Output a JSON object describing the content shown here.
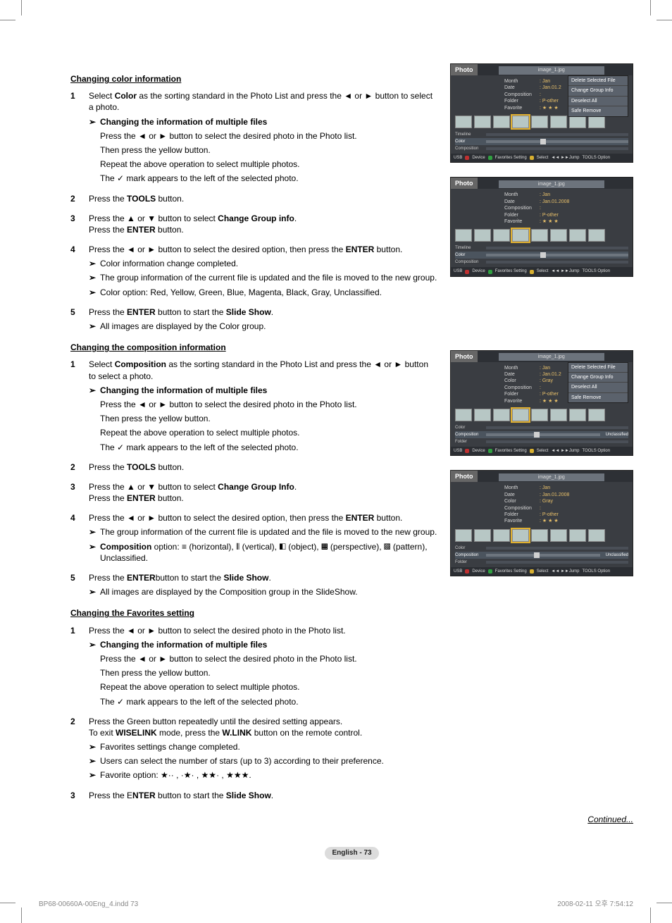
{
  "sections": {
    "color": {
      "heading": "Changing color information",
      "steps": [
        {
          "n": "1",
          "lines": [
            "Select ",
            "Color",
            " as the sorting standard in the Photo List and press the ◄ or ► button to select a photo."
          ],
          "sub": [
            {
              "t": "Changing the information of multiple files",
              "bold": true
            },
            {
              "t": "Press the ◄ or ► button to select the desired photo in the Photo list."
            },
            {
              "t": "Then press the yellow button."
            },
            {
              "t": "Repeat the above operation to select multiple photos."
            },
            {
              "t": "The ✓ mark appears to the left of the selected photo."
            }
          ]
        },
        {
          "n": "2",
          "lines": [
            "Press the ",
            "TOOLS",
            " button."
          ]
        },
        {
          "n": "3",
          "lines": [
            "Press the ▲ or ▼ button to select ",
            "Change Group info",
            ".\nPress the ",
            "ENTER",
            " button."
          ]
        },
        {
          "n": "4",
          "lines": [
            "Press the ◄ or ► button to select the desired option, then press the ",
            "ENTER",
            " button."
          ],
          "bullets": [
            "Color information change completed.",
            "The group information of the current file is updated and the file is moved to the new group.",
            "Color option: Red, Yellow, Green, Blue, Magenta, Black, Gray, Unclassified."
          ]
        },
        {
          "n": "5",
          "lines": [
            "Press the ",
            "ENTER",
            " button to start the ",
            "Slide Show",
            "."
          ],
          "bullets": [
            "All images are displayed by the Color group."
          ]
        }
      ]
    },
    "composition": {
      "heading": "Changing the composition information",
      "steps": [
        {
          "n": "1",
          "lines": [
            "Select ",
            "Composition",
            " as the sorting standard in the Photo List and press the ◄ or ► button to select a photo."
          ],
          "sub": [
            {
              "t": "Changing the information of multiple files",
              "bold": true
            },
            {
              "t": "Press the ◄ or ► button to select the desired photo in the Photo list."
            },
            {
              "t": "Then press the yellow button."
            },
            {
              "t": "Repeat the above operation to select multiple photos."
            },
            {
              "t": "The ✓ mark appears to the left of the selected photo."
            }
          ]
        },
        {
          "n": "2",
          "lines": [
            "Press the ",
            "TOOLS",
            " button."
          ]
        },
        {
          "n": "3",
          "lines": [
            "Press the ▲ or ▼ button to select ",
            "Change Group Info",
            ".\nPress the ",
            "ENTER",
            " button."
          ]
        },
        {
          "n": "4",
          "lines": [
            "Press the ◄ or ► button to select the desired option, then press the ",
            "ENTER",
            " button."
          ],
          "bullets": [
            "The group information of the current file is updated and the file is moved to the new group.",
            "Composition option: ≡ (horizontal), ⦀ (vertical), ◧ (object), ▦ (perspective), ▩ (pattern), Unclassified."
          ],
          "bulletBoldPrefix": [
            null,
            "Composition"
          ]
        },
        {
          "n": "5",
          "lines": [
            "Press the ",
            "ENTER",
            "button to start the ",
            "Slide Show",
            "."
          ],
          "bullets": [
            "All images are displayed by the Composition group in the SlideShow."
          ]
        }
      ]
    },
    "favorites": {
      "heading": "Changing the Favorites setting",
      "steps": [
        {
          "n": "1",
          "lines": [
            "Press the ◄ or ► button to select the desired photo in the Photo list."
          ],
          "sub": [
            {
              "t": "Changing the information of multiple files",
              "bold": true
            },
            {
              "t": "Press the ◄ or ► button to select the desired photo in the Photo list."
            },
            {
              "t": "Then press the yellow button."
            },
            {
              "t": "Repeat the above operation to select multiple photos."
            },
            {
              "t": "The ✓ mark appears to the left of the selected photo."
            }
          ]
        },
        {
          "n": "2",
          "lines": [
            "Press the Green button repeatedly until the desired setting appears.\nTo exit ",
            "WISELINK",
            " mode, press the ",
            "W.LINK",
            " button on the remote control."
          ],
          "bullets": [
            "Favorites settings change completed.",
            "Users can select the number of stars (up to 3) according to their preference.",
            "Favorite option: ★·· , ·★· , ★★· , ★★★."
          ]
        },
        {
          "n": "3",
          "lines": [
            "Press the E",
            "NTER",
            " button to start the ",
            "Slide Show",
            "."
          ]
        }
      ]
    }
  },
  "continued": "Continued...",
  "page_pill": "English - 73",
  "footer_left": "BP68-00660A-00Eng_4.indd   73",
  "footer_right": "2008-02-11   오후 7:54:12",
  "popup_items": [
    "Delete Selected File",
    "Change Group Info",
    "Deselect All",
    "Safe Remove"
  ],
  "shots": {
    "file": "image_1.jpg",
    "title": "Photo",
    "meta_keys": [
      "Month",
      "Date",
      "Composition",
      "Folder",
      "Favorite"
    ],
    "meta_keys_color": [
      "Month",
      "Date",
      "Color",
      "Composition",
      "Folder",
      "Favorite"
    ],
    "meta_vals": {
      "Month": ": Jan",
      "Date": ": Jan.01.2008",
      "Composition": ":",
      "Folder": ": P-other",
      "Favorite": ": ★ ★ ★",
      "Color": ": Gray"
    },
    "sort": {
      "timeline": "Timeline",
      "color": "Color",
      "composition": "Composition",
      "folder": "Folder",
      "unclassified": "Unclassified"
    },
    "foot": {
      "usb": "USB",
      "device": "Device",
      "fav": "Favorites Setting",
      "select": "Select",
      "jump": "◄◄ ►►Jump",
      "option": "TOOLS Option"
    }
  }
}
